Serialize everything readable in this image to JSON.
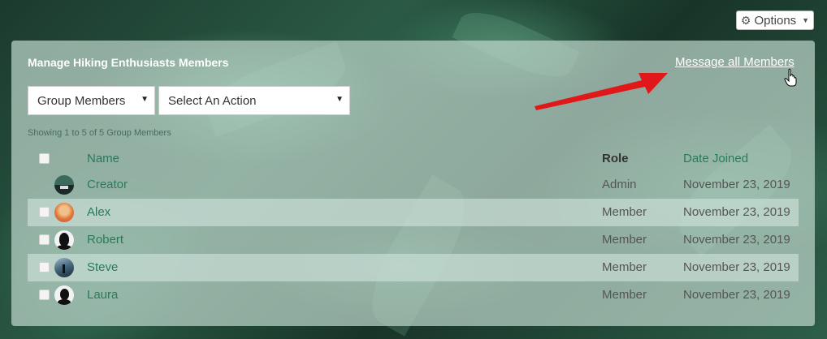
{
  "options": {
    "label": "Options"
  },
  "panel": {
    "title": "Manage Hiking Enthusiasts Members",
    "message_all": "Message all Members",
    "filter_select": "Group Members",
    "action_select": "Select An Action",
    "showing": "Showing 1 to 5 of 5 Group Members"
  },
  "table": {
    "headers": {
      "name": "Name",
      "role": "Role",
      "date": "Date Joined"
    },
    "rows": [
      {
        "name": "Creator",
        "role": "Admin",
        "date": "November 23, 2019"
      },
      {
        "name": "Alex",
        "role": "Member",
        "date": "November 23, 2019"
      },
      {
        "name": "Robert",
        "role": "Member",
        "date": "November 23, 2019"
      },
      {
        "name": "Steve",
        "role": "Member",
        "date": "November 23, 2019"
      },
      {
        "name": "Laura",
        "role": "Member",
        "date": "November 23, 2019"
      }
    ]
  },
  "colors": {
    "link_green": "#2a7a5c",
    "arrow_red": "#e0181a"
  }
}
